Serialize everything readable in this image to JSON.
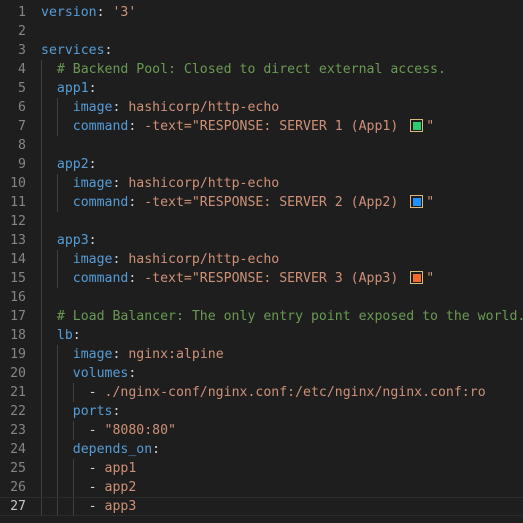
{
  "editor": {
    "current_line": 27,
    "lines": [
      {
        "n": "1",
        "tokens": [
          {
            "t": "version",
            "c": "k"
          },
          {
            "t": ": ",
            "c": "p"
          },
          {
            "t": "'3'",
            "c": "s"
          }
        ]
      },
      {
        "n": "2",
        "tokens": []
      },
      {
        "n": "3",
        "tokens": [
          {
            "t": "services",
            "c": "k"
          },
          {
            "t": ":",
            "c": "p"
          }
        ]
      },
      {
        "n": "4",
        "tokens": [
          {
            "t": "  "
          },
          {
            "t": "# Backend Pool: Closed to direct external access.",
            "c": "c"
          }
        ]
      },
      {
        "n": "5",
        "tokens": [
          {
            "t": "  "
          },
          {
            "t": "app1",
            "c": "k"
          },
          {
            "t": ":",
            "c": "p"
          }
        ]
      },
      {
        "n": "6",
        "tokens": [
          {
            "t": "    "
          },
          {
            "t": "image",
            "c": "k"
          },
          {
            "t": ": ",
            "c": "p"
          },
          {
            "t": "hashicorp/http-echo",
            "c": "s"
          }
        ]
      },
      {
        "n": "7",
        "tokens": [
          {
            "t": "    "
          },
          {
            "t": "command",
            "c": "k"
          },
          {
            "t": ": ",
            "c": "p"
          },
          {
            "t": "-text=\"RESPONSE: SERVER 1 (App1) ",
            "c": "s"
          },
          {
            "swatch": "#2ecc71"
          },
          {
            "t": "\"",
            "c": "s"
          }
        ]
      },
      {
        "n": "8",
        "tokens": []
      },
      {
        "n": "9",
        "tokens": [
          {
            "t": "  "
          },
          {
            "t": "app2",
            "c": "k"
          },
          {
            "t": ":",
            "c": "p"
          }
        ]
      },
      {
        "n": "10",
        "tokens": [
          {
            "t": "    "
          },
          {
            "t": "image",
            "c": "k"
          },
          {
            "t": ": ",
            "c": "p"
          },
          {
            "t": "hashicorp/http-echo",
            "c": "s"
          }
        ]
      },
      {
        "n": "11",
        "tokens": [
          {
            "t": "    "
          },
          {
            "t": "command",
            "c": "k"
          },
          {
            "t": ": ",
            "c": "p"
          },
          {
            "t": "-text=\"RESPONSE: SERVER 2 (App2) ",
            "c": "s"
          },
          {
            "swatch": "#1e90ff"
          },
          {
            "t": "\"",
            "c": "s"
          }
        ]
      },
      {
        "n": "12",
        "tokens": []
      },
      {
        "n": "13",
        "tokens": [
          {
            "t": "  "
          },
          {
            "t": "app3",
            "c": "k"
          },
          {
            "t": ":",
            "c": "p"
          }
        ]
      },
      {
        "n": "14",
        "tokens": [
          {
            "t": "    "
          },
          {
            "t": "image",
            "c": "k"
          },
          {
            "t": ": ",
            "c": "p"
          },
          {
            "t": "hashicorp/http-echo",
            "c": "s"
          }
        ]
      },
      {
        "n": "15",
        "tokens": [
          {
            "t": "    "
          },
          {
            "t": "command",
            "c": "k"
          },
          {
            "t": ": ",
            "c": "p"
          },
          {
            "t": "-text=\"RESPONSE: SERVER 3 (App3) ",
            "c": "s"
          },
          {
            "swatch": "#f26b2a"
          },
          {
            "t": "\"",
            "c": "s"
          }
        ]
      },
      {
        "n": "16",
        "tokens": []
      },
      {
        "n": "17",
        "tokens": [
          {
            "t": "  "
          },
          {
            "t": "# Load Balancer: The only entry point exposed to the world.",
            "c": "c"
          }
        ]
      },
      {
        "n": "18",
        "tokens": [
          {
            "t": "  "
          },
          {
            "t": "lb",
            "c": "k"
          },
          {
            "t": ":",
            "c": "p"
          }
        ]
      },
      {
        "n": "19",
        "tokens": [
          {
            "t": "    "
          },
          {
            "t": "image",
            "c": "k"
          },
          {
            "t": ": ",
            "c": "p"
          },
          {
            "t": "nginx:alpine",
            "c": "s"
          }
        ]
      },
      {
        "n": "20",
        "tokens": [
          {
            "t": "    "
          },
          {
            "t": "volumes",
            "c": "k"
          },
          {
            "t": ":",
            "c": "p"
          }
        ]
      },
      {
        "n": "21",
        "tokens": [
          {
            "t": "      "
          },
          {
            "t": "- ",
            "c": "p"
          },
          {
            "t": "./nginx-conf/nginx.conf:/etc/nginx/nginx.conf:ro",
            "c": "s"
          }
        ]
      },
      {
        "n": "22",
        "tokens": [
          {
            "t": "    "
          },
          {
            "t": "ports",
            "c": "k"
          },
          {
            "t": ":",
            "c": "p"
          }
        ]
      },
      {
        "n": "23",
        "tokens": [
          {
            "t": "      "
          },
          {
            "t": "- ",
            "c": "p"
          },
          {
            "t": "\"8080:80\"",
            "c": "s"
          }
        ]
      },
      {
        "n": "24",
        "tokens": [
          {
            "t": "    "
          },
          {
            "t": "depends_on",
            "c": "k"
          },
          {
            "t": ":",
            "c": "p"
          }
        ]
      },
      {
        "n": "25",
        "tokens": [
          {
            "t": "      "
          },
          {
            "t": "- ",
            "c": "p"
          },
          {
            "t": "app1",
            "c": "s"
          }
        ]
      },
      {
        "n": "26",
        "tokens": [
          {
            "t": "      "
          },
          {
            "t": "- ",
            "c": "p"
          },
          {
            "t": "app2",
            "c": "s"
          }
        ]
      },
      {
        "n": "27",
        "tokens": [
          {
            "t": "      "
          },
          {
            "t": "- ",
            "c": "p"
          },
          {
            "t": "app3",
            "c": "s"
          }
        ]
      }
    ]
  },
  "colors": {
    "background": "#1e1e1e",
    "key": "#569cd6",
    "string": "#ce9178",
    "comment": "#6a9955",
    "line_number": "#858585",
    "swatch_border": "#d7ba7d"
  }
}
